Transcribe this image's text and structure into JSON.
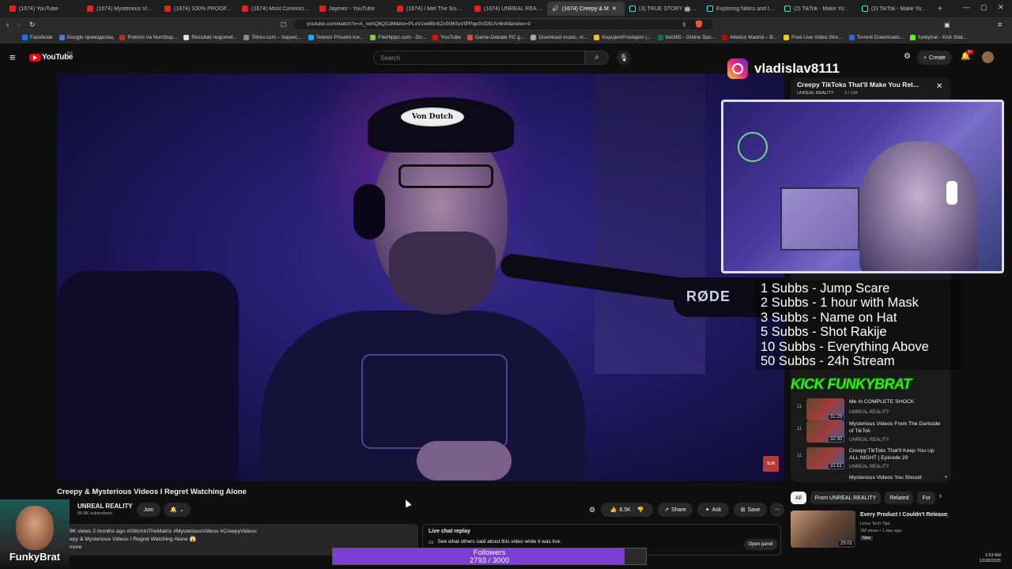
{
  "browser": {
    "tabs": [
      {
        "label": "(1674) YouTube"
      },
      {
        "label": "(1674) Mysterious Videos I"
      },
      {
        "label": "(1674) 100% PROOF, PARA"
      },
      {
        "label": "(1674) Most Convincing Evi"
      },
      {
        "label": "Jaymez - YouTube"
      },
      {
        "label": "(1674) I Met The Scientist T"
      },
      {
        "label": "(1674) UNREAL REALITY -"
      },
      {
        "label": "(1674) Creepy & M"
      },
      {
        "label": "(3) TRUE STORY 🤖 #iteeni"
      },
      {
        "label": "Exploring Nibiru and the N"
      },
      {
        "label": "(2) TikTok - Make Your Day"
      },
      {
        "label": "(2) TikTok - Make Your Day"
      }
    ],
    "url": "youtube.com/watch?v=A_nehQ6QS3M&list=PLxV1Ie6Bn9Zx50tKfuVtPPqeSVD5UV4kW&index=3",
    "bookmarks": [
      "Facebook",
      "Google преводилац",
      "Pokloni na NonStop...",
      "Rezultati nogomet...",
      "Titlovi.com – Najveć...",
      "Telenor Privatni kor...",
      "FileHippo.com - Do...",
      "YouTube",
      "Game-Debate PC g...",
      "Download music, m...",
      "KupujemProdajem |...",
      "bet365 - Online Spo...",
      "Atletico Madrid – B...",
      "Free Live Video Stre...",
      "Torrent Downloads...",
      "funkytrat - Kick Stat..."
    ]
  },
  "youtube": {
    "logo": "YouTube",
    "logo_region": "RS",
    "search_placeholder": "Search",
    "create_label": "Create",
    "notif_count": "9+"
  },
  "overlay": {
    "instagram_handle": "vladislav8111",
    "goals": [
      "1 Subbs - Jump Scare",
      "2 Subbs - 1 hour with Mask",
      "3 Subbs - Name on Hat",
      "5 Subbs - Shot Rakije",
      "10 Subbs - Everything Above",
      "50 Subbs - 24h Stream"
    ],
    "kick_text": "KICK FUNKYBRAT",
    "streamer_name": "FunkyBrat",
    "followers_label": "Followers",
    "followers_count": "2793 / 3000",
    "followers_progress": 0.931
  },
  "playlist": {
    "title": "Creepy TikToks That'll Make You Ret...",
    "channel": "UNREAL REALITY",
    "position": "3 / 134",
    "items": [
      {
        "num": "11",
        "title": "Me In COMPLETE SHOCK",
        "channel": "UNREAL REALITY",
        "duration": "31:29"
      },
      {
        "num": "11",
        "title": "Mysterious Videos From The Darkside of TikTok",
        "channel": "UNREAL REALITY",
        "duration": "32:30"
      },
      {
        "num": "11",
        "title": "Creepy TikToks That'll Keep You Up ALL NIGHT | Episode 29",
        "channel": "UNREAL REALITY",
        "duration": "31:51"
      },
      {
        "num": "",
        "title": "Mysterious Videos You Should",
        "channel": "",
        "duration": ""
      }
    ]
  },
  "video": {
    "title": "Creepy & Mysterious Videos I Regret Watching Alone",
    "channel_name": "UNREAL REALITY",
    "subscribers": "90.8K subscribers",
    "join_label": "Join",
    "likes": "8.5K",
    "share_label": "Share",
    "ask_label": "Ask",
    "save_label": "Save",
    "description_meta": "9K views  2 months ago  #GlitchInTheMatrix #MysteriousVideos #CreepyVideos",
    "description_line2": "epy & Mysterious Videos I Regret Watching Alone 😱",
    "more_label": "more",
    "live_chat_title": "Live chat replay",
    "live_chat_text": "See what others said about this video while it was live.",
    "open_panel_label": "Open panel",
    "mic_brand": "RØDE",
    "hat_text": "Von Dutch"
  },
  "sidebar": {
    "chips": [
      "All",
      "From UNREAL REALITY",
      "Related",
      "For"
    ],
    "rec_title": "Every Product I Couldn't Release",
    "rec_channel": "Linus Tech Tips",
    "rec_meta": "1M views • 1 day ago",
    "rec_badge": "New",
    "rec_duration": "25:01"
  },
  "system": {
    "time": "1:53 AM",
    "date": "12/28/2025"
  },
  "colors": {
    "yt_red": "#ff0000",
    "progress_fill": "#7b3fd1",
    "background": "#0f0f0f"
  }
}
